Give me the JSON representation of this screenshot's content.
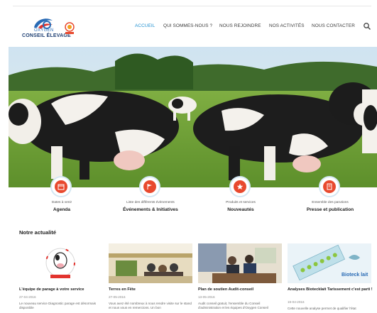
{
  "brand": {
    "line1": "OXYGEN",
    "line2": "CONSEIL ÉLEVAGE",
    "badge_label": "BRETAGNE"
  },
  "nav": {
    "items": [
      {
        "label": "ACCUEIL",
        "active": true
      },
      {
        "label": "QUI SOMMES-NOUS ?",
        "active": false
      },
      {
        "label": "NOUS REJOINDRE",
        "active": false
      },
      {
        "label": "NOS ACTIVITÉS",
        "active": false
      },
      {
        "label": "NOUS CONTACTER",
        "active": false
      }
    ],
    "search_icon": "search-icon"
  },
  "colors": {
    "accent": "#1f8fd1",
    "feature_red": "#e8492e",
    "logo_blue": "#2a6bb5",
    "logo_red": "#e2332e"
  },
  "features": [
    {
      "sub": "Dates à venir",
      "title": "Agenda",
      "icon": "calendar-icon"
    },
    {
      "sub": "Liste des différents évènements",
      "title": "Événements & Initiatives",
      "icon": "flag-icon"
    },
    {
      "sub": "Produits et services",
      "title": "Nouveautés",
      "icon": "star-icon"
    },
    {
      "sub": "Ensemble des parutions",
      "title": "Presse et publication",
      "icon": "book-icon"
    }
  ],
  "news": {
    "heading": "Notre actualité",
    "cards": [
      {
        "title": "L'équipe de parage à votre service",
        "date": "27-04-2016",
        "text": "Le nouveau service Diagnostic parage est désormais disponible"
      },
      {
        "title": "Terres en Fête",
        "date": "27-05-2016",
        "text": "Vous avez été nombreux à nous rendre visite sur le stand et nous vous en remercions. Un bon"
      },
      {
        "title": "Plan de soutien Audit-conseil",
        "date": "13-05-2016",
        "text": "Audit conseil gratuit, l'ensemble du Conseil d'administration et les équipes d'Oxygen Conseil"
      },
      {
        "title": "Analyses Biotecklait Tarissement c'est parti !",
        "date": "19-04-2016",
        "text": "Cette nouvelle analyse permet de qualifier l'état"
      }
    ],
    "card4_img_label": "Bioteck lait"
  }
}
